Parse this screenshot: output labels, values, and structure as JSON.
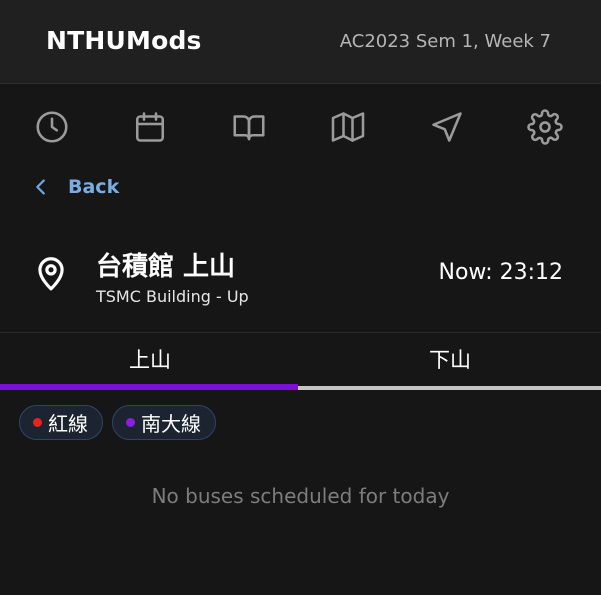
{
  "header": {
    "app_title": "NTHUMods",
    "semester_label": "AC2023 Sem 1, Week 7"
  },
  "nav": {
    "icons": [
      "clock-icon",
      "calendar-icon",
      "book-open-icon",
      "map-icon",
      "navigation-icon",
      "settings-icon"
    ]
  },
  "back": {
    "label": "Back"
  },
  "stop": {
    "name": "台積館 上山",
    "subtitle": "TSMC Building - Up",
    "now_label": "Now: 23:12"
  },
  "tabs": [
    {
      "label": "上山",
      "active": true
    },
    {
      "label": "下山",
      "active": false
    }
  ],
  "routes": [
    {
      "label": "紅線",
      "color": "#e8231a"
    },
    {
      "label": "南大線",
      "color": "#8a1ee6"
    }
  ],
  "empty_message": "No buses scheduled for today",
  "colors": {
    "accent": "#7b0ed8",
    "link": "#7aaee3",
    "inactive_tab_bar": "#c4c4c4"
  }
}
